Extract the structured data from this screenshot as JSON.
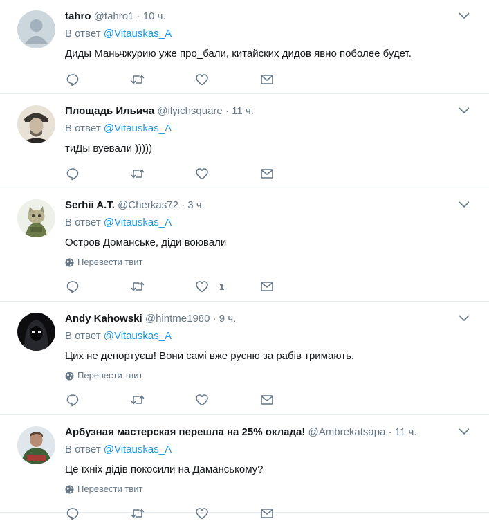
{
  "reply_prefix": "В ответ",
  "translate_label": "Перевести твит",
  "colors": {
    "link": "#1b95e0",
    "muted": "#657786",
    "text": "#14171a",
    "divider": "#e6ecf0"
  },
  "tweets": [
    {
      "name": "tahro",
      "handle": "@tahro1",
      "time": "10 ч.",
      "reply_to": "@Vitauskas_A",
      "text": "Диды Маньчжурию уже про_бали, китайских дидов явно поболее будет.",
      "avatar_icon": "default-avatar-icon",
      "show_translate": false,
      "like_count": ""
    },
    {
      "name": "Площадь Ильича",
      "handle": "@ilyichsquare",
      "time": "11 ч.",
      "reply_to": "@Vitauskas_A",
      "text": "тиДы вуевали )))))",
      "avatar_icon": "portrait-avatar-icon",
      "show_translate": false,
      "like_count": ""
    },
    {
      "name": "Serhii A.T.",
      "handle": "@Cherkas72",
      "time": "3 ч.",
      "reply_to": "@Vitauskas_A",
      "text": "Остров Доманське, діди воювали",
      "avatar_icon": "soldier-cat-avatar-icon",
      "show_translate": true,
      "like_count": "1"
    },
    {
      "name": "Andy Kahowski",
      "handle": "@hintme1980",
      "time": "9 ч.",
      "reply_to": "@Vitauskas_A",
      "text": "Цих не депортуєш! Вони самі вже русню за рабів тримають.",
      "avatar_icon": "hooded-figure-avatar-icon",
      "show_translate": true,
      "like_count": ""
    },
    {
      "name": "Арбузная мастерская перешла на 25% оклада!",
      "handle": "@Ambrekatsapa",
      "time": "11 ч.",
      "reply_to": "@Vitauskas_A",
      "text": "Це їхніх дідів покосили на Даманському?",
      "avatar_icon": "person-avatar-icon",
      "show_translate": true,
      "like_count": ""
    }
  ]
}
